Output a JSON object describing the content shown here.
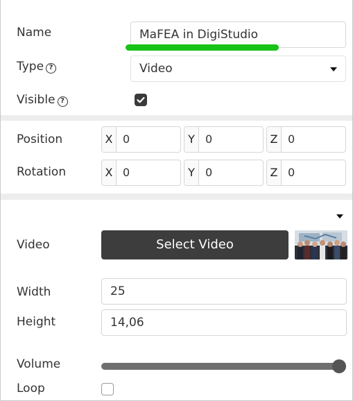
{
  "general": {
    "name_label": "Name",
    "name_value": "MaFEA in DigiStudio",
    "type_label": "Type",
    "type_value": "Video",
    "visible_label": "Visible",
    "visible_checked": true,
    "help_glyph": "?"
  },
  "transform": {
    "position_label": "Position",
    "rotation_label": "Rotation",
    "position": {
      "x_label": "X",
      "x": "0",
      "y_label": "Y",
      "y": "0",
      "z_label": "Z",
      "z": "0"
    },
    "rotation": {
      "x_label": "X",
      "x": "0",
      "y_label": "Y",
      "y": "0",
      "z_label": "Z",
      "z": "0"
    }
  },
  "video": {
    "video_label": "Video",
    "select_button_label": "Select Video",
    "width_label": "Width",
    "width_value": "25",
    "height_label": "Height",
    "height_value": "14,06",
    "volume_label": "Volume",
    "volume_level": 1.0,
    "loop_label": "Loop",
    "loop_checked": false
  },
  "colors": {
    "highlight_underline": "#17c317",
    "button_bg": "#3d3d3d",
    "checkbox_checked": "#3a3a3a",
    "separator": "#ededed"
  },
  "icons": [
    "help-icon",
    "dropdown-caret-icon",
    "checkmark-icon",
    "video-thumbnail"
  ]
}
